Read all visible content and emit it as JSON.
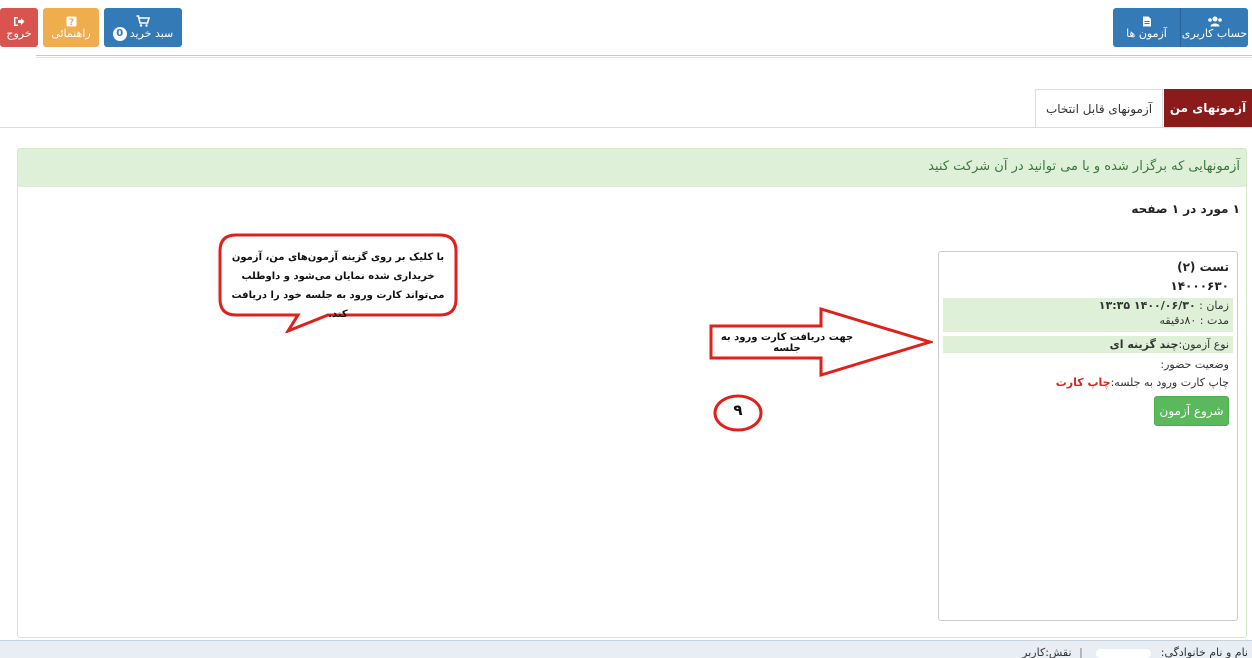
{
  "topbar": {
    "logout_label": "خروج",
    "help_label": "راهنمائی",
    "cart_label": "سبد خرید",
    "cart_count": "0",
    "account_label": "حساب کاربری",
    "exams_label": "آزمون ها"
  },
  "tabs": [
    {
      "label": "آزمونهای من",
      "active": true
    },
    {
      "label": "آزمونهای قابل انتخاب",
      "active": false
    }
  ],
  "panel": {
    "heading": "آزمونهایی که برگزار شده و یا می توانید در آن شرکت کنید",
    "count": "۱ مورد در ۱ صفحه"
  },
  "exam_card": {
    "title": "تست (۲)",
    "code": "۱۴۰۰۰۶۳۰",
    "time_label": "زمان :",
    "time_value": "۱۴۰۰/۰۶/۳۰ ۱۳:۳۵",
    "duration_label": "مدت :",
    "duration_value": "۸۰دقیقه",
    "type_label": "نوع آزمون:",
    "type_value": "چند گزینه ای",
    "attendance_label": "وضعیت حضور:",
    "print_label": "چاپ کارت ورود به جلسه:",
    "print_link": "چاپ کارت",
    "start_button": "شروع آزمون"
  },
  "annotations": {
    "callout_text": "با کلیک بر روی گزینه آزمون‌های من، آزمون خریداری شده نمایان می‌شود و داوطلب می‌تواند کارت ورود به جلسه خود را دریافت کند.",
    "arrow_text": "جهت دریافت کارت ورود به جلسه",
    "step_number": "۹"
  },
  "footer": {
    "name_label": "نام و نام خانوادگی:",
    "role_label": "نقش:کاربر"
  },
  "colors": {
    "primary": "#337ab7",
    "danger": "#d9534f",
    "warning": "#f0ad4e",
    "success": "#5cb85c",
    "active_tab": "#8b1a1a",
    "annotation_red": "#e0201b"
  },
  "icons": {
    "logout": "sign-out-icon",
    "help": "question-icon",
    "cart": "shopping-cart-icon",
    "account": "users-icon",
    "exams": "file-icon"
  }
}
